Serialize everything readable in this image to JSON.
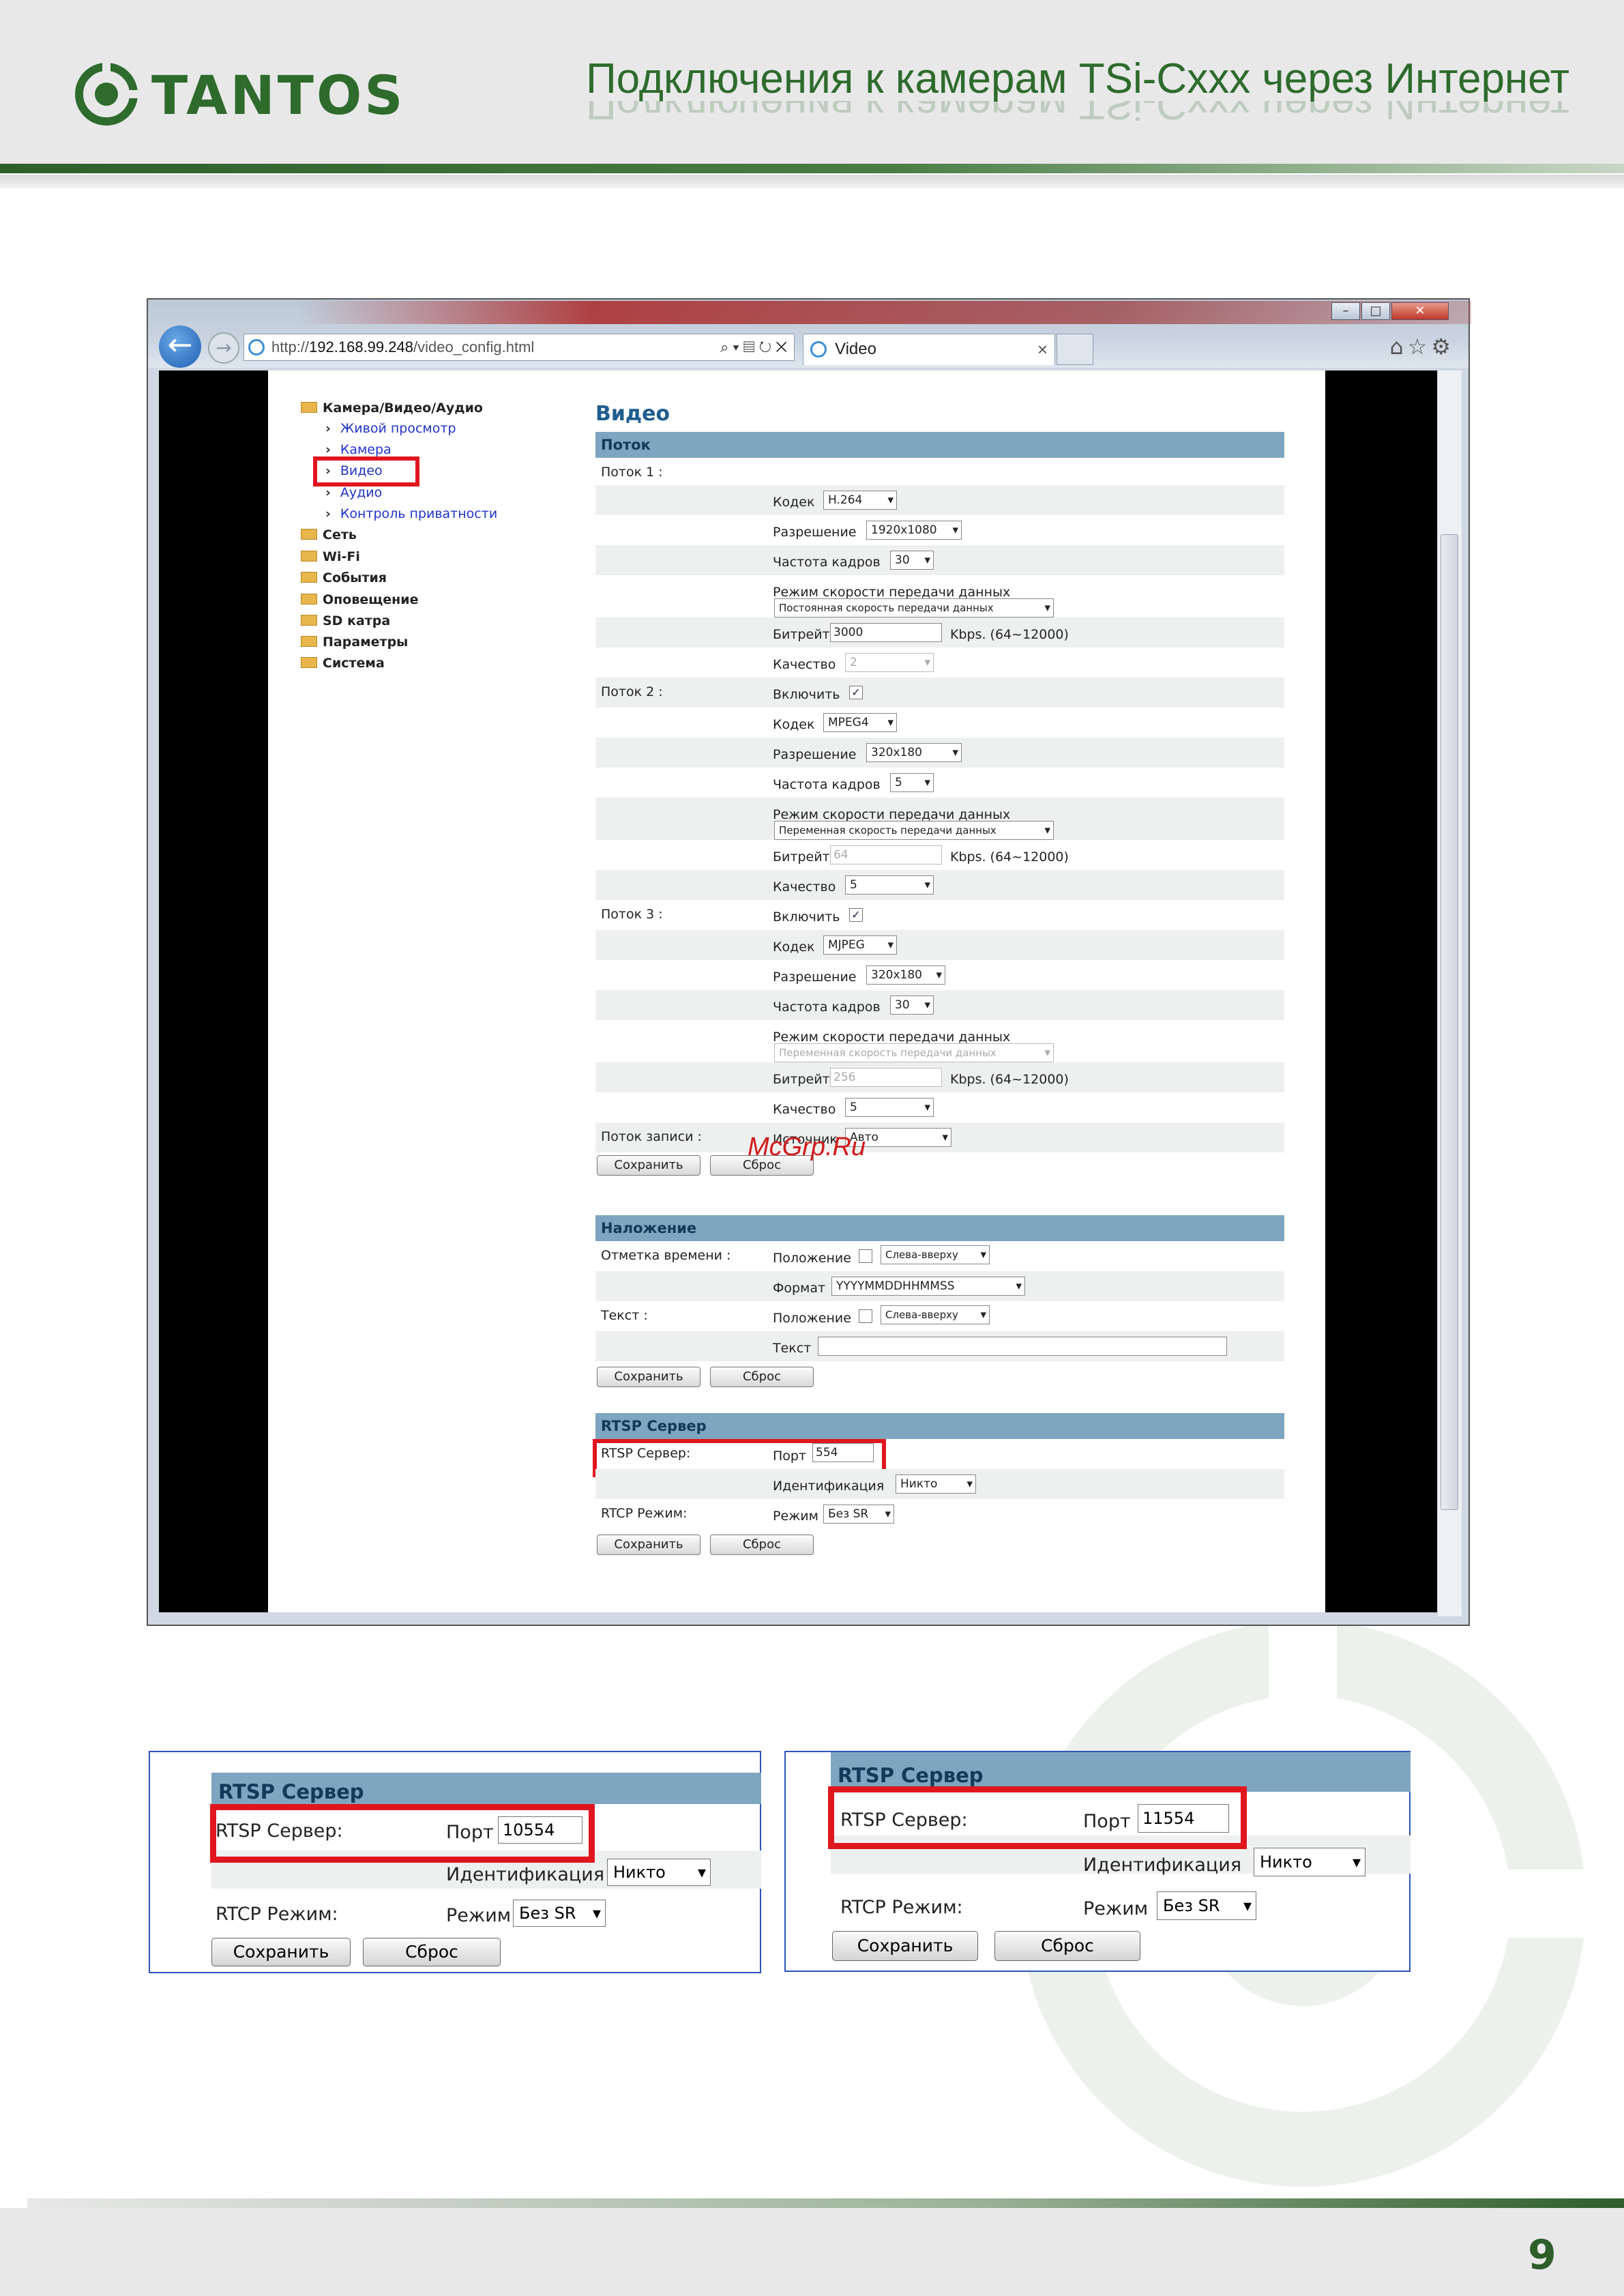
{
  "header": {
    "logo_text": "TANTOS",
    "title": "Подключения к камерам TSi-Cxxx через Интернет"
  },
  "browser": {
    "url_host": "192.168.99.248",
    "url_prefix": "http://",
    "url_path": "/video_config.html",
    "tab_title": "Video"
  },
  "nav": {
    "root": "Камера/Видео/Аудио",
    "sub": [
      "Живой просмотр",
      "Камера",
      "Видео",
      "Аудио",
      "Контроль приватности"
    ],
    "folders": [
      "Сеть",
      "Wi-Fi",
      "События",
      "Оповещение",
      "SD катра",
      "Параметры",
      "Система"
    ]
  },
  "page_title": "Видео",
  "stream_section": {
    "title": "Поток",
    "stream1_label": "Поток 1 :",
    "stream2_label": "Поток 2 :",
    "stream3_label": "Поток 3 :",
    "record_label": "Поток записи :",
    "codec_label": "Кодек",
    "resolution_label": "Разрешение",
    "fps_label": "Частота кадров",
    "ratemode_label": "Режим скорости передачи данных",
    "bitrate_label": "Битрейт",
    "bitrate_unit": "Kbps. (64~12000)",
    "quality_label": "Качество",
    "enable_label": "Включить",
    "source_label": "Источник",
    "s1": {
      "codec": "H.264",
      "resolution": "1920x1080",
      "fps": "30",
      "ratemode": "Постоянная скорость передачи данных",
      "bitrate": "3000",
      "quality": "2"
    },
    "s2": {
      "codec": "MPEG4",
      "resolution": "320x180",
      "fps": "5",
      "ratemode": "Переменная скорость передачи данных",
      "bitrate": "64",
      "quality": "5"
    },
    "s3": {
      "codec": "MJPEG",
      "resolution": "320x180",
      "fps": "30",
      "ratemode": "Переменная скорость передачи данных",
      "bitrate": "256",
      "quality": "5"
    },
    "source": "Авто",
    "check_mark": "✓"
  },
  "overlay_section": {
    "title": "Наложение",
    "timestamp_label": "Отметка времени :",
    "position_label": "Положение",
    "position_value": "Слева-вверху",
    "format_label": "Формат",
    "format_value": "YYYYMMDDHHMMSS",
    "text_row_label": "Текст :",
    "text_label": "Текст"
  },
  "rtsp_section": {
    "title": "RTSP Сервер",
    "server_label": "RTSP Сервер:",
    "port_label": "Порт",
    "port_value": "554",
    "auth_label": "Идентификация",
    "auth_value": "Никто",
    "rtcp_label": "RTCP Режим:",
    "mode_label": "Режим",
    "mode_value": "Без SR"
  },
  "buttons": {
    "save": "Сохранить",
    "reset": "Сброс"
  },
  "panel_left": {
    "port_value": "10554"
  },
  "panel_right": {
    "port_value": "11554"
  },
  "watermark_text": "McGrp.Ru",
  "page_number": "9"
}
